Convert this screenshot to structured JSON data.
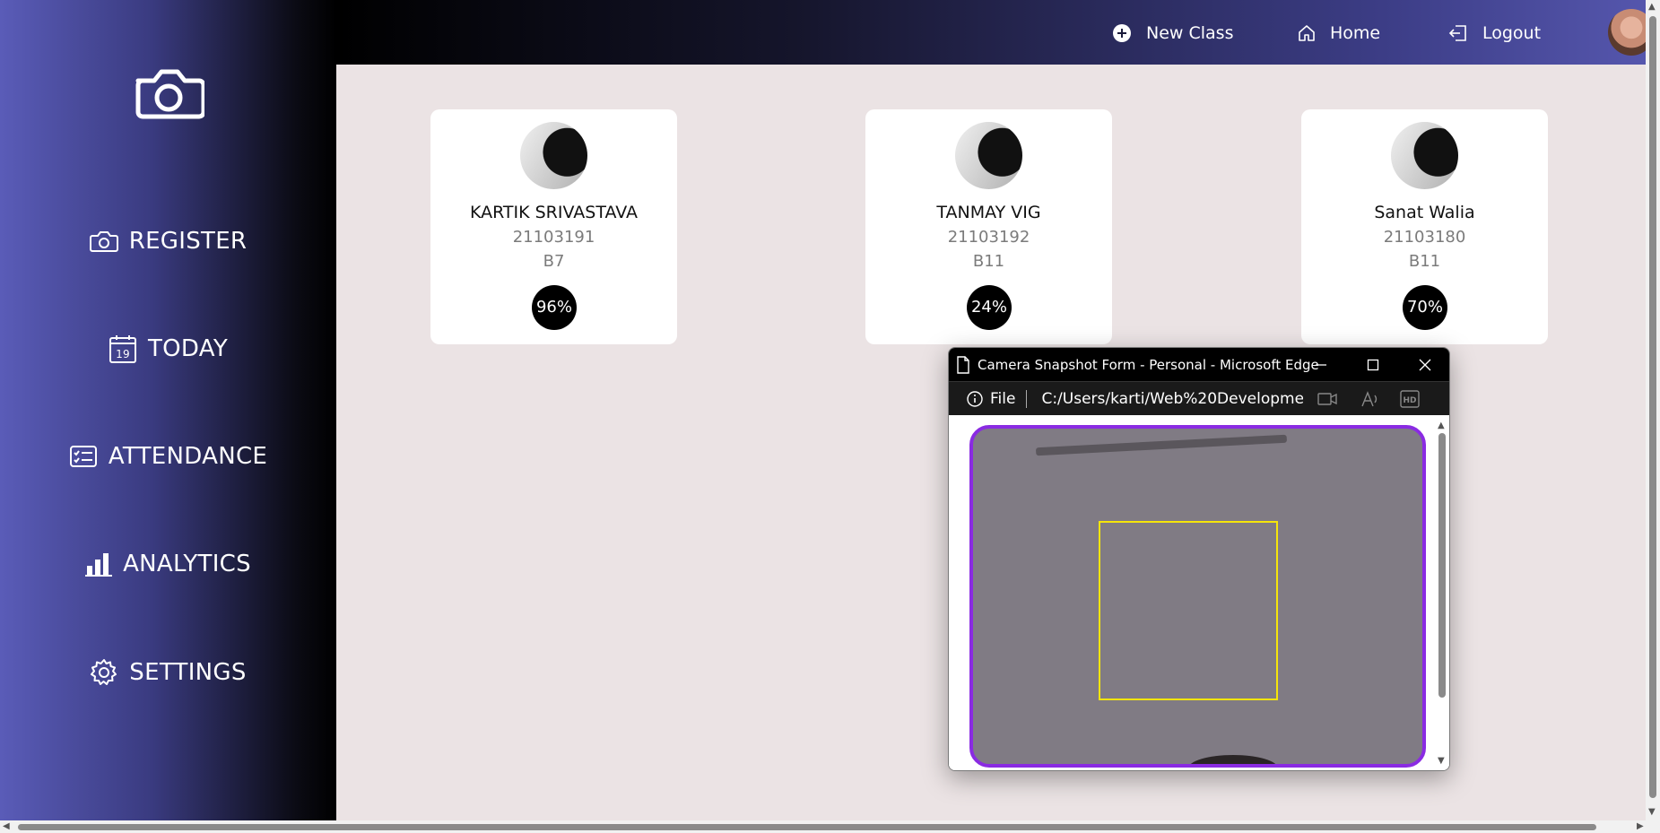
{
  "sidebar": {
    "items": [
      {
        "label": "REGISTER",
        "icon": "camera-icon"
      },
      {
        "label": "TODAY",
        "icon": "calendar-icon",
        "calendar_day": "19"
      },
      {
        "label": "ATTENDANCE",
        "icon": "checklist-icon"
      },
      {
        "label": "ANALYTICS",
        "icon": "bar-chart-icon"
      },
      {
        "label": "SETTINGS",
        "icon": "gear-icon"
      }
    ]
  },
  "topbar": {
    "new_class": "New Class",
    "home": "Home",
    "logout": "Logout"
  },
  "students": [
    {
      "name": "KARTIK SRIVASTAVA",
      "roll": "21103191",
      "batch": "B7",
      "attendance": "96%"
    },
    {
      "name": "TANMAY VIG",
      "roll": "21103192",
      "batch": "B11",
      "attendance": "24%"
    },
    {
      "name": "Sanat Walia",
      "roll": "21103180",
      "batch": "B11",
      "attendance": "70%"
    }
  ],
  "popup": {
    "title": "Camera Snapshot Form - Personal - Microsoft Edge",
    "file_label": "File",
    "url": "C:/Users/karti/Web%20Developmen..."
  },
  "colors": {
    "camera_border": "#8a2be2",
    "face_box": "#f5e50a",
    "main_bg": "#ebe3e4"
  }
}
